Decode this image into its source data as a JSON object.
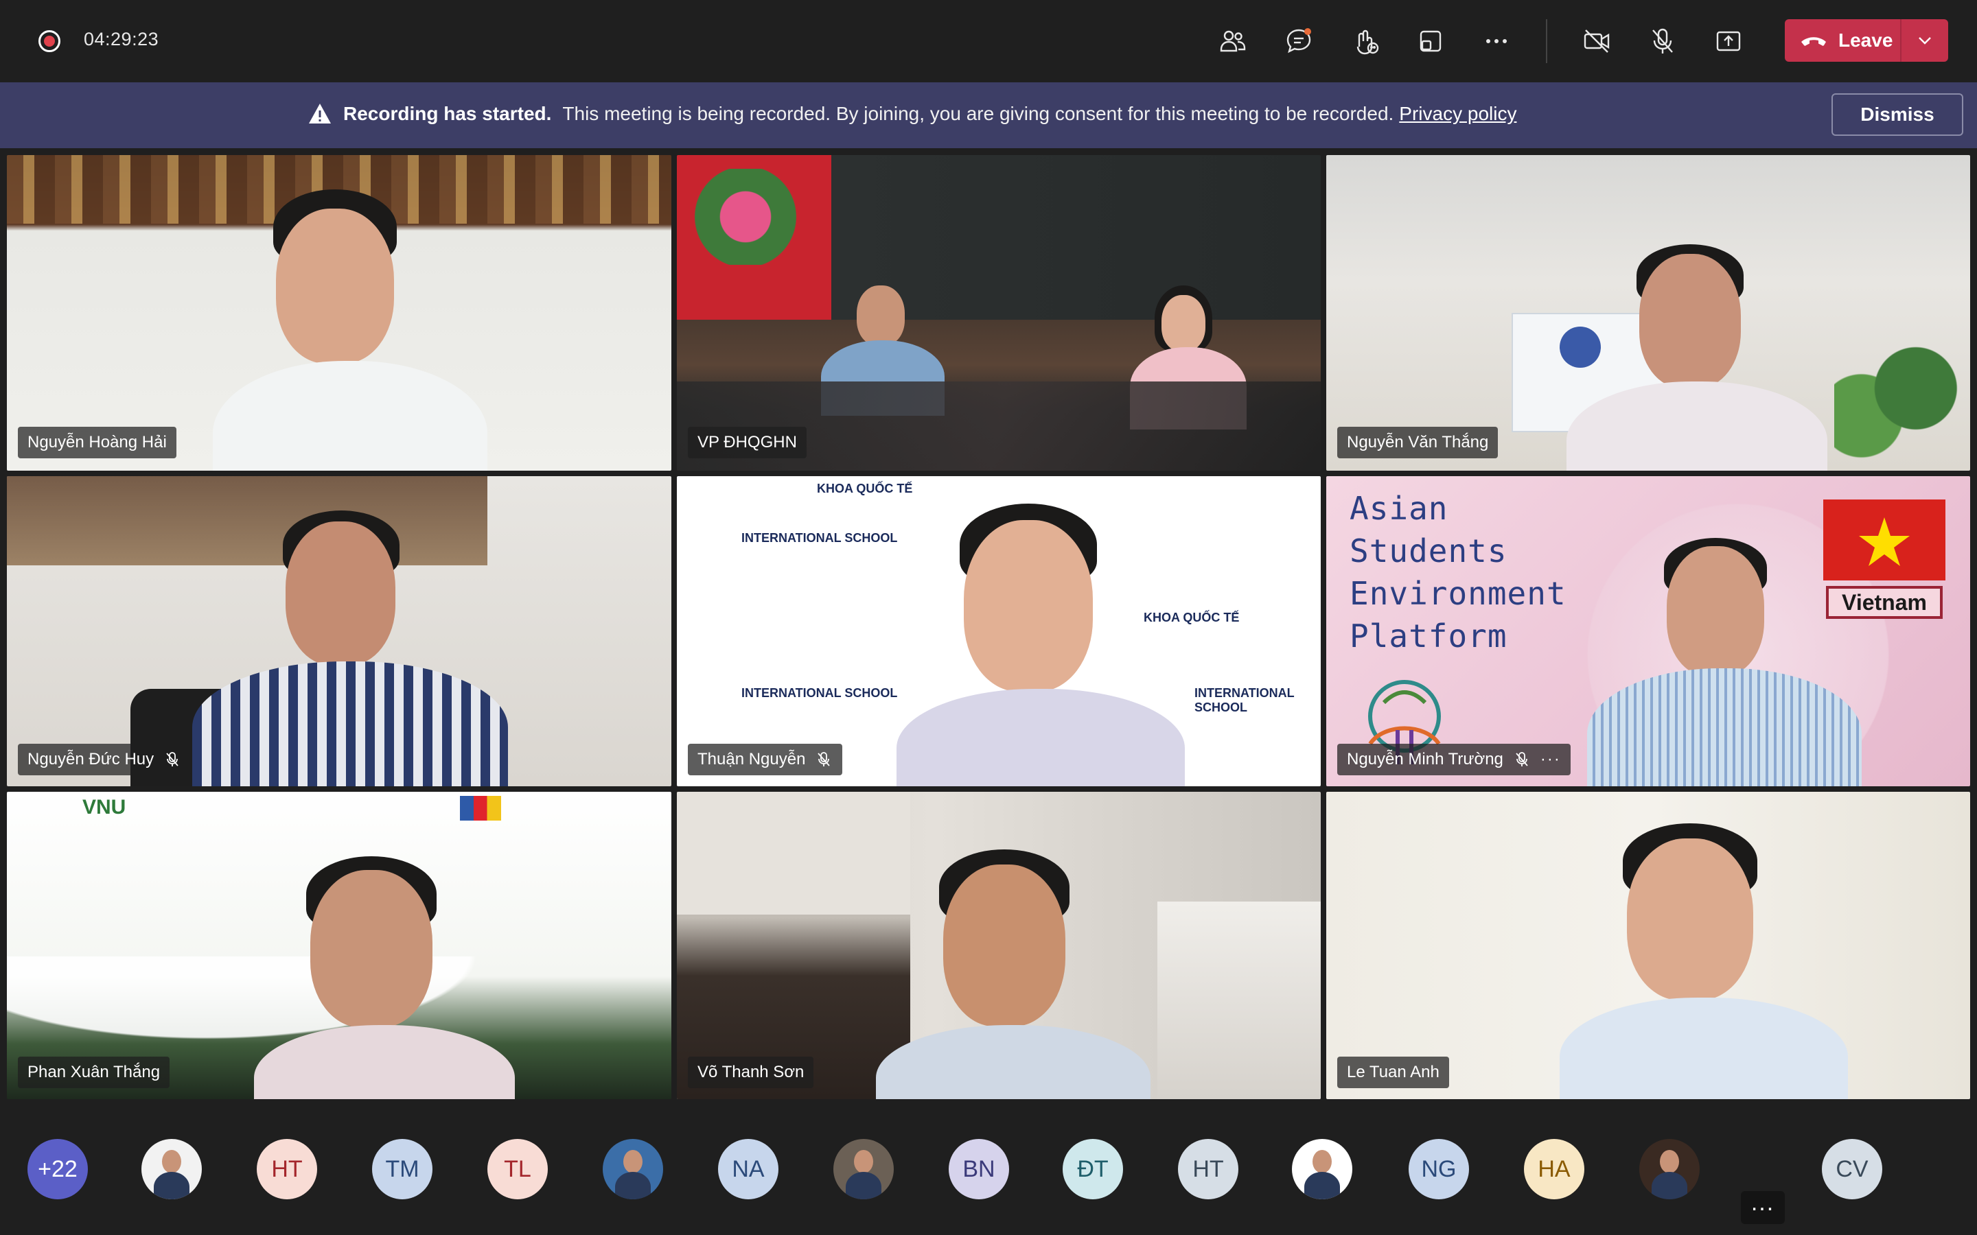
{
  "call": {
    "elapsed_time": "04:29:23",
    "leave_label": "Leave"
  },
  "toolbar_icons": [
    "people-icon",
    "chat-icon",
    "react-icon",
    "share-view-icon",
    "more-icon",
    "camera-off-icon",
    "mic-off-icon",
    "share-screen-icon"
  ],
  "banner": {
    "title": "Recording has started.",
    "text": "This meeting is being recorded. By joining, you are giving consent for this meeting to be recorded.",
    "link": "Privacy policy",
    "dismiss_label": "Dismiss"
  },
  "participants": [
    {
      "name": "Nguyễn Hoàng Hải",
      "muted": false
    },
    {
      "name": "VP ĐHQGHN",
      "muted": false
    },
    {
      "name": "Nguyễn Văn Thắng",
      "muted": false
    },
    {
      "name": "Nguyễn Đức Huy",
      "muted": true
    },
    {
      "name": "Thuận Nguyễn",
      "muted": true
    },
    {
      "name": "Nguyễn Minh Trường",
      "muted": true
    },
    {
      "name": "Phan Xuân Thắng",
      "muted": false
    },
    {
      "name": "Võ Thanh Sơn",
      "muted": false
    },
    {
      "name": "Le Tuan Anh",
      "muted": false
    }
  ],
  "background_text": {
    "asep_lines": [
      "Asian",
      "Students",
      "Environment",
      "Platform"
    ],
    "flag_label": "Vietnam",
    "school_logo": "INTERNATIONAL SCHOOL",
    "khoa_quoc_te": "KHOA QUỐC TẾ",
    "vnu_logo": "VNU"
  },
  "avatar_strip": [
    {
      "label": "+22",
      "bg": "#5b5fc7",
      "fg": "#ffffff"
    },
    {
      "label": "",
      "bg": "#f2f2f2",
      "fg": "#333333",
      "photo": true
    },
    {
      "label": "HT",
      "bg": "#f8dcd5",
      "fg": "#a4262c"
    },
    {
      "label": "TM",
      "bg": "#c7d6ec",
      "fg": "#2b4a7a"
    },
    {
      "label": "TL",
      "bg": "#f8dcd5",
      "fg": "#a4262c"
    },
    {
      "label": "",
      "bg": "#3b6ea8",
      "fg": "#ffffff",
      "photo": true
    },
    {
      "label": "NA",
      "bg": "#c7d6ec",
      "fg": "#2b4a7a"
    },
    {
      "label": "",
      "bg": "#6b6055",
      "fg": "#ffffff",
      "photo": true
    },
    {
      "label": "BN",
      "bg": "#d6d3ec",
      "fg": "#3b3a7a"
    },
    {
      "label": "ĐT",
      "bg": "#cfe8ec",
      "fg": "#1f5e6a"
    },
    {
      "label": "HT",
      "bg": "#d6dee6",
      "fg": "#3a4a5a"
    },
    {
      "label": "",
      "bg": "#ffffff",
      "fg": "#333333",
      "photo": true
    },
    {
      "label": "NG",
      "bg": "#c7d6ec",
      "fg": "#2b4a7a"
    },
    {
      "label": "HA",
      "bg": "#f8e7c4",
      "fg": "#8a5a00"
    },
    {
      "label": "",
      "bg": "#3a2a22",
      "fg": "#ffffff",
      "photo": true
    },
    {
      "label": "CV",
      "bg": "#d6dee6",
      "fg": "#3a4a5a"
    }
  ],
  "colors": {
    "accent": "#5b5fc7",
    "leave_red": "#c4314b",
    "banner_bg": "#3d3e66",
    "app_bg": "#1f1f1f"
  }
}
